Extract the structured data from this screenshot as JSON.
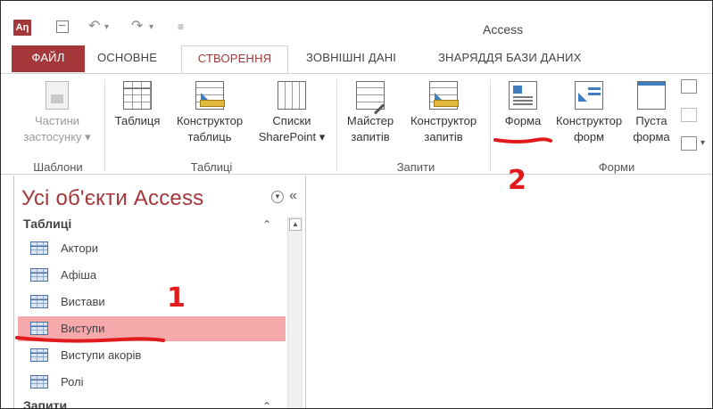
{
  "window": {
    "title": "Access",
    "app_badge": "Aη"
  },
  "qat": {
    "undo": "↶",
    "redo": "↷",
    "customize": "≡"
  },
  "tabs": [
    {
      "label": "ФАЙЛ"
    },
    {
      "label": "ОСНОВНЕ"
    },
    {
      "label": "СТВОРЕННЯ"
    },
    {
      "label": "ЗОВНІШНІ ДАНІ"
    },
    {
      "label": "ЗНАРЯДДЯ БАЗИ ДАНИХ"
    }
  ],
  "ribbon": {
    "templates": {
      "btn1": "Частини",
      "btn2": "застосунку",
      "group": "Шаблони"
    },
    "tables": {
      "table": "Таблиця",
      "design1": "Конструктор",
      "design2": "таблиць",
      "sp1": "Списки",
      "sp2": "SharePoint",
      "group": "Таблиці"
    },
    "queries": {
      "wiz1": "Майстер",
      "wiz2": "запитів",
      "design1": "Конструктор",
      "design2": "запитів",
      "group": "Запити"
    },
    "forms": {
      "form": "Форма",
      "design1": "Конструктор",
      "design2": "форм",
      "blank1": "Пуста",
      "blank2": "форма",
      "group": "Форми"
    }
  },
  "nav": {
    "title": "Усі об'єкти Access",
    "sections": [
      {
        "label": "Таблиці"
      },
      {
        "label": "Запити"
      }
    ],
    "items": [
      {
        "label": "Актори"
      },
      {
        "label": "Афіша"
      },
      {
        "label": "Вистави"
      },
      {
        "label": "Виступи",
        "selected": true
      },
      {
        "label": "Виступи акорів"
      },
      {
        "label": "Ролі"
      }
    ]
  },
  "annotations": {
    "one": "1",
    "two": "2"
  },
  "colors": {
    "accent": "#a4373a",
    "highlight": "#f7f300",
    "selection": "#f5a9ab",
    "annotation": "#e11b1b"
  }
}
